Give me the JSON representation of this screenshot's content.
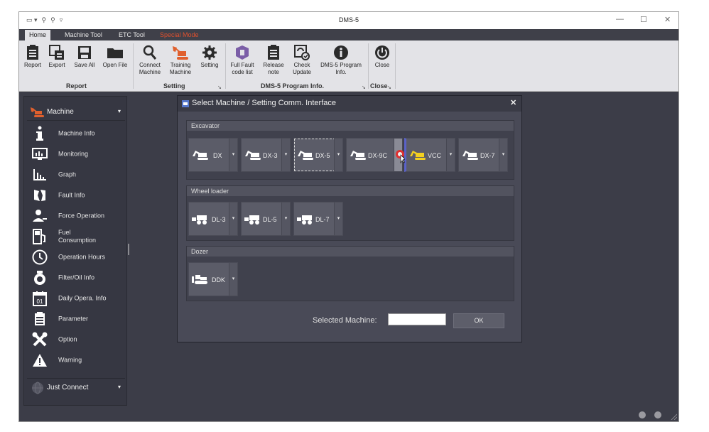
{
  "window": {
    "title": "DMS-5",
    "quick_access": [
      "▭ ▾",
      "⚲",
      "⚲",
      "▿"
    ],
    "controls": {
      "minimize": "—",
      "maximize": "☐",
      "close": "✕"
    }
  },
  "tabs": [
    "Home",
    "Machine Tool",
    "ETC Tool",
    "Special Mode"
  ],
  "ribbon": {
    "groups": [
      {
        "label": "Report",
        "buttons": [
          {
            "label": "Report",
            "icon": "report-icon"
          },
          {
            "label": "Export",
            "icon": "export-icon"
          },
          {
            "label": "Save All",
            "icon": "save-icon"
          },
          {
            "label": "Open File",
            "icon": "folder-icon"
          }
        ]
      },
      {
        "label": "Setting",
        "buttons": [
          {
            "label": "Connect Machine",
            "icon": "search-icon"
          },
          {
            "label": "Training Machine",
            "icon": "excavator-icon"
          },
          {
            "label": "Setting",
            "icon": "gear-icon"
          }
        ]
      },
      {
        "label": "DMS-5 Program Info.",
        "buttons": [
          {
            "label": "Full Fault code list",
            "icon": "shield-icon"
          },
          {
            "label": "Release note",
            "icon": "clipboard-icon"
          },
          {
            "label": "Check Update",
            "icon": "update-icon"
          },
          {
            "label": "DMS-5 Program Info.",
            "icon": "info-icon"
          }
        ]
      },
      {
        "label": "Close",
        "buttons": [
          {
            "label": "Close",
            "icon": "power-icon"
          }
        ]
      }
    ],
    "launcher": "↘"
  },
  "sidebar": {
    "header": "Machine",
    "items": [
      {
        "label": "Machine Info",
        "icon": "info-icon"
      },
      {
        "label": "Monitoring",
        "icon": "monitor-icon"
      },
      {
        "label": "Graph",
        "icon": "graph-icon"
      },
      {
        "label": "Fault Info",
        "icon": "fault-icon"
      },
      {
        "label": "Force Operation",
        "icon": "user-icon"
      },
      {
        "label": "Fuel\nConsumption",
        "icon": "fuel-icon"
      },
      {
        "label": "Operation Hours",
        "icon": "clock-icon"
      },
      {
        "label": "Filter/Oil Info",
        "icon": "filter-icon"
      },
      {
        "label": "Daily Opera. Info",
        "icon": "calendar-icon"
      },
      {
        "label": "Parameter",
        "icon": "clipboard-icon"
      },
      {
        "label": "Option",
        "icon": "tools-icon"
      },
      {
        "label": "Warning",
        "icon": "warning-icon"
      }
    ],
    "footer": "Just Connect",
    "calendar_day": "01"
  },
  "dialog": {
    "title": "Select Machine / Setting Comm. Interface",
    "close": "✕",
    "sections": [
      {
        "label": "Excavator",
        "machines": [
          "DX",
          "DX-3",
          "DX-5",
          "DX-9C",
          "VCC",
          "DX-7"
        ]
      },
      {
        "label": "Wheel loader",
        "machines": [
          "DL-3",
          "DL-5",
          "DL-7"
        ]
      },
      {
        "label": "Dozer",
        "machines": [
          "DDK"
        ]
      }
    ],
    "selected_label": "Selected Machine:",
    "selected_value": "",
    "ok": "OK"
  },
  "dropdown_glyph": "▾",
  "colors": {
    "accent_orange": "#e0502e",
    "background": "#3c3d48",
    "ribbon": "#e3e3e7"
  }
}
